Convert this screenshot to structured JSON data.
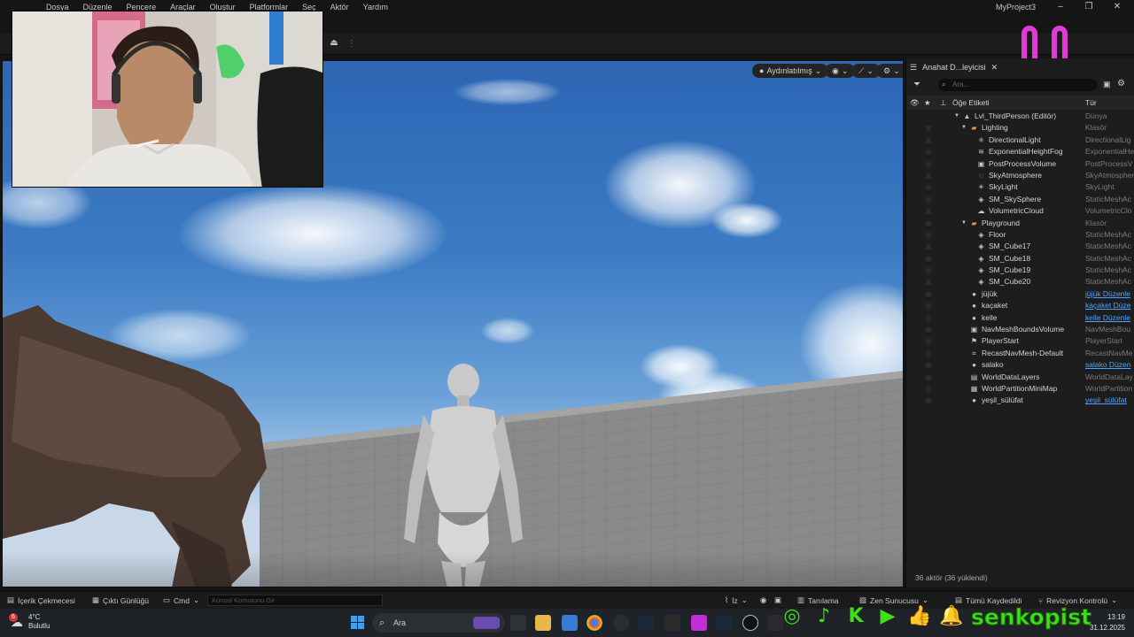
{
  "menu": {
    "items": [
      "Dosya",
      "Düzenle",
      "Pencere",
      "Araçlar",
      "Oluştur",
      "Platformlar",
      "Seç",
      "Aktör",
      "Yardım"
    ],
    "project_title": "MyProject3"
  },
  "viewport": {
    "lighting_mode": "Aydınlatılmış"
  },
  "outliner": {
    "tab_label": "Anahat D...leyicisi",
    "search_placeholder": "Ara...",
    "col_label": "Öğe Etiketi",
    "col_type": "Tür",
    "items": [
      {
        "name": "Lvl_ThirdPerson (Editör)",
        "type": "Dünya",
        "level": 0,
        "icon": "level",
        "link": false
      },
      {
        "name": "Lighting",
        "type": "Klasör",
        "level": 1,
        "icon": "folder",
        "link": false
      },
      {
        "name": "DirectionalLight",
        "type": "DirectionalLig",
        "level": 2,
        "icon": "sun",
        "link": false
      },
      {
        "name": "ExponentialHeightFog",
        "type": "ExponentialHe",
        "level": 2,
        "icon": "fog",
        "link": false
      },
      {
        "name": "PostProcessVolume",
        "type": "PostProcessV",
        "level": 2,
        "icon": "box",
        "link": false
      },
      {
        "name": "SkyAtmosphere",
        "type": "SkyAtmosphere",
        "level": 2,
        "icon": "sky",
        "link": false
      },
      {
        "name": "SkyLight",
        "type": "SkyLight",
        "level": 2,
        "icon": "skylight",
        "link": false
      },
      {
        "name": "SM_SkySphere",
        "type": "StaticMeshAc",
        "level": 2,
        "icon": "cube",
        "link": false
      },
      {
        "name": "VolumetricCloud",
        "type": "VolumetricClo",
        "level": 2,
        "icon": "cloud",
        "link": false
      },
      {
        "name": "Playground",
        "type": "Klasör",
        "level": 1,
        "icon": "folder",
        "link": false
      },
      {
        "name": "Floor",
        "type": "StaticMeshAc",
        "level": 2,
        "icon": "cube",
        "link": false
      },
      {
        "name": "SM_Cube17",
        "type": "StaticMeshAc",
        "level": 2,
        "icon": "cube",
        "link": false
      },
      {
        "name": "SM_Cube18",
        "type": "StaticMeshAc",
        "level": 2,
        "icon": "cube",
        "link": false
      },
      {
        "name": "SM_Cube19",
        "type": "StaticMeshAc",
        "level": 2,
        "icon": "cube",
        "link": false
      },
      {
        "name": "SM_Cube20",
        "type": "StaticMeshAc",
        "level": 2,
        "icon": "cube",
        "link": false
      },
      {
        "name": "jüjük",
        "type": "jüjük Düzenle",
        "level": 1,
        "icon": "pawn",
        "link": true
      },
      {
        "name": "kaçaket",
        "type": "kaçaket Düze",
        "level": 1,
        "icon": "pawn",
        "link": true
      },
      {
        "name": "kelle",
        "type": "kelle Düzenle",
        "level": 1,
        "icon": "pawn",
        "link": true
      },
      {
        "name": "NavMeshBoundsVolume",
        "type": "NavMeshBou",
        "level": 1,
        "icon": "box",
        "link": false
      },
      {
        "name": "PlayerStart",
        "type": "PlayerStart",
        "level": 1,
        "icon": "flag",
        "link": false
      },
      {
        "name": "RecastNavMesh-Default",
        "type": "RecastNavMe",
        "level": 1,
        "icon": "nav",
        "link": false
      },
      {
        "name": "salako",
        "type": "salako Düzen",
        "level": 1,
        "icon": "pawn",
        "link": true
      },
      {
        "name": "WorldDataLayers",
        "type": "WorldDataLay",
        "level": 1,
        "icon": "layers",
        "link": false
      },
      {
        "name": "WorldPartitionMiniMap",
        "type": "WorldPartition",
        "level": 1,
        "icon": "map",
        "link": false
      },
      {
        "name": "yeşil_sülüfat",
        "type": "yeşil_sülüfat",
        "level": 1,
        "icon": "pawn",
        "link": true
      }
    ],
    "footer": "36 aktör (36 yüklendi)"
  },
  "bottom_bar": {
    "content_drawer": "İçerik Çekmecesi",
    "output_log": "Çıktı Günlüğü",
    "cmd": "Cmd",
    "console_placeholder": "Konsol Komutunu Gir",
    "trace": "İz",
    "diagnostics": "Tanılama",
    "zen_server": "Zen Sunucusu",
    "all_saved": "Tümü Kaydedildi",
    "revision_control": "Revizyon Kontrolü"
  },
  "taskbar": {
    "weather_temp": "4°C",
    "weather_desc": "Bulutlu",
    "weather_badge": "6",
    "search_label": "Ara",
    "time": "13:19",
    "date": "31.12.2025"
  },
  "overlay": {
    "streamer_name": "senkopist"
  },
  "colors": {
    "accent_green": "#3fe01a",
    "smiley_pink": "#e23ad6",
    "link_blue": "#4fa3ff"
  }
}
